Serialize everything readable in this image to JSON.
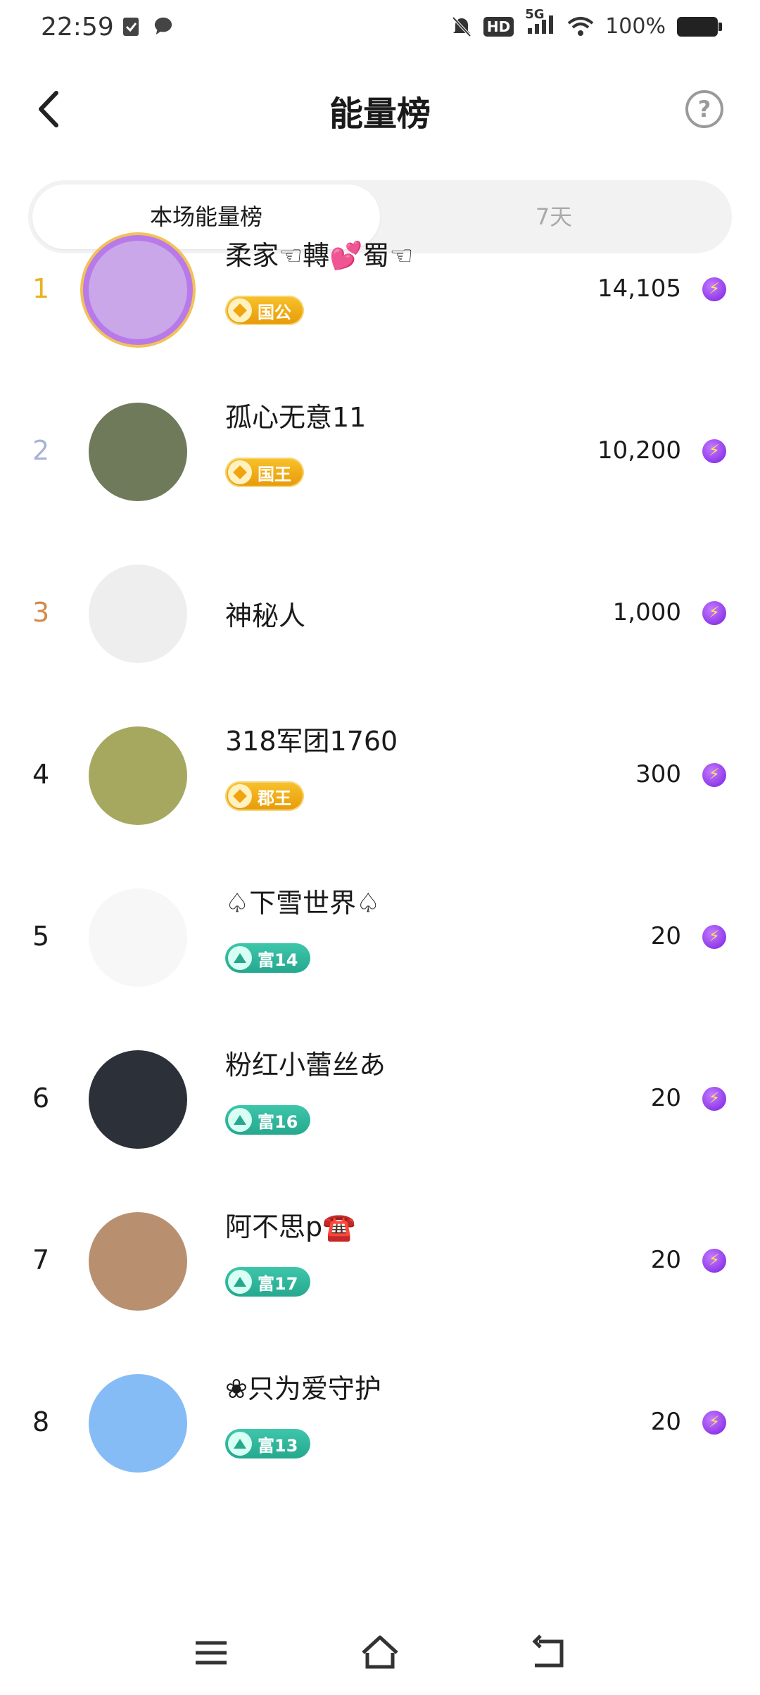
{
  "status_bar": {
    "time": "22:59",
    "network": "5G",
    "hd": "HD",
    "battery": "100%"
  },
  "header": {
    "title": "能量榜",
    "help_symbol": "?"
  },
  "tabs": [
    {
      "label": "本场能量榜",
      "active": true
    },
    {
      "label": "7天",
      "active": false
    }
  ],
  "ranking": [
    {
      "rank": "1",
      "rank_color": "#e8b321",
      "name": "柔家☜轉💕蜀☜",
      "badge": "国公",
      "badge_type": "gold",
      "score": "14,105",
      "avatar_color": "#c9a7e8"
    },
    {
      "rank": "2",
      "rank_color": "#a9b3d6",
      "name": "孤心无意11",
      "badge": "国王",
      "badge_type": "gold",
      "score": "10,200",
      "avatar_color": "#6f7a5a"
    },
    {
      "rank": "3",
      "rank_color": "#d38a4a",
      "name": "神秘人",
      "badge": "",
      "badge_type": "none",
      "score": "1,000",
      "avatar_color": "#eeeeee"
    },
    {
      "rank": "4",
      "rank_color": "#1a1a1a",
      "name": "318军团1760",
      "badge": "郡王",
      "badge_type": "gold",
      "score": "300",
      "avatar_color": "#a6a860"
    },
    {
      "rank": "5",
      "rank_color": "#1a1a1a",
      "name": "♤下雪世界♤",
      "badge": "富14",
      "badge_type": "teal",
      "score": "20",
      "avatar_color": "#f7f7f7"
    },
    {
      "rank": "6",
      "rank_color": "#1a1a1a",
      "name": "粉红小蕾丝あ",
      "badge": "富16",
      "badge_type": "teal",
      "score": "20",
      "avatar_color": "#2c3038"
    },
    {
      "rank": "7",
      "rank_color": "#1a1a1a",
      "name": "阿不思p☎️",
      "badge": "富17",
      "badge_type": "teal",
      "score": "20",
      "avatar_color": "#b89070"
    },
    {
      "rank": "8",
      "rank_color": "#1a1a1a",
      "name": "❀只为爱守护",
      "badge": "富13",
      "badge_type": "teal",
      "score": "20",
      "avatar_color": "#86bcf5"
    }
  ],
  "energy_icon": "lightning-energy-icon",
  "bottom_nav": [
    "menu-icon",
    "home-icon",
    "back-nav-icon"
  ]
}
